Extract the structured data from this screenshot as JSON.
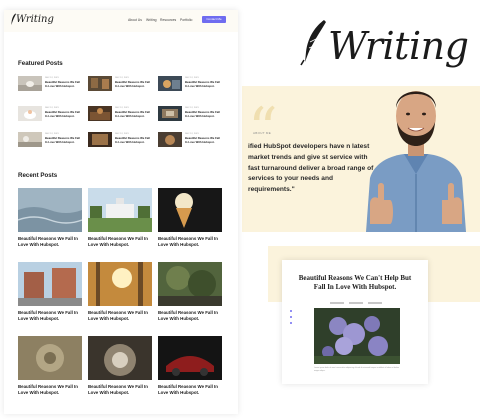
{
  "brand": {
    "name": "Writing"
  },
  "site": {
    "logo_text": "Writing",
    "nav": [
      "About Us",
      "Writing",
      "Resources",
      "Portfolio"
    ],
    "cta_label": "Contact Me"
  },
  "featured": {
    "heading": "Featured Posts",
    "posts": [
      {
        "date": "DEC 12, 2021",
        "title": "Beautiful Reasons We Fall In Love With Hubspot."
      },
      {
        "date": "DEC 12, 2021",
        "title": "Beautiful Reasons We Fall In Love With Hubspot."
      },
      {
        "date": "DEC 12, 2021",
        "title": "Beautiful Reasons We Fall In Love With Hubspot."
      },
      {
        "date": "DEC 12, 2021",
        "title": "Beautiful Reasons We Fall In Love With Hubspot."
      },
      {
        "date": "DEC 12, 2021",
        "title": "Beautiful Reasons We Fall In Love With Hubspot."
      },
      {
        "date": "DEC 12, 2021",
        "title": "Beautiful Reasons We Fall In Love With Hubspot."
      }
    ]
  },
  "recent": {
    "heading": "Recent Posts",
    "posts": [
      {
        "title": "Beautiful Reasons We Fall In Love With Hubspot."
      },
      {
        "title": "Beautiful Reasons We Fall In Love With Hubspot."
      },
      {
        "title": "Beautiful Reasons We Fall In Love With Hubspot."
      },
      {
        "title": "Beautiful Reasons We Fall In Love With Hubspot."
      },
      {
        "title": "Beautiful Reasons We Fall In Love With Hubspot."
      },
      {
        "title": "Beautiful Reasons We Fall In Love With Hubspot."
      },
      {
        "title": "Beautiful Reasons We Fall In Love With Hubspot."
      },
      {
        "title": "Beautiful Reasons We Fall In Love With Hubspot."
      },
      {
        "title": "Beautiful Reasons We Fall In Love With Hubspot."
      }
    ]
  },
  "testimonial": {
    "label": "ABOUT ME",
    "quote": "ified HubSpot developers have n latest market trends and give st service with fast turnaround deliver a broad range of services to your needs and requirements.\""
  },
  "card": {
    "title": "Beautiful Reasons We Can't Help But Fall In Love With Hubspot.",
    "caption": "Lorem ipsum dolor sit amet consectetur adipiscing elit sed do eiusmod tempor incididunt ut labore et dolore magna aliqua."
  },
  "colors": {
    "accent": "#6f6cf0",
    "cream": "#fbf3dc"
  }
}
